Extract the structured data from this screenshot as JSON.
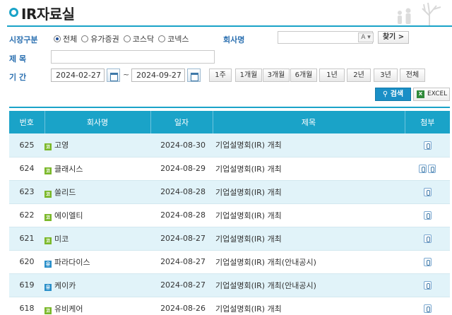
{
  "page": {
    "title": "IR자료실"
  },
  "filters": {
    "market_label": "시장구분",
    "market_options": [
      {
        "label": "전체",
        "checked": true
      },
      {
        "label": "유가증권",
        "checked": false
      },
      {
        "label": "코스닥",
        "checked": false
      },
      {
        "label": "코넥스",
        "checked": false
      }
    ],
    "company_label": "회사명",
    "company_value": "",
    "autocomplete_label": "A ▾",
    "find_label": "찾기 >",
    "subject_label": "제 목",
    "subject_value": "",
    "period_label": "기 간",
    "start_date": "2024-02-27",
    "date_separator": "~",
    "end_date": "2024-09-27",
    "period_buttons": [
      "1주",
      "1개월",
      "3개월",
      "6개월",
      "1년",
      "2년",
      "3년",
      "전체"
    ],
    "search_label": "검색",
    "excel_label": "EXCEL",
    "excel_icon_letter": "X"
  },
  "table": {
    "columns": [
      "번호",
      "회사명",
      "일자",
      "제목",
      "첨부"
    ],
    "rows": [
      {
        "no": "625",
        "market_badge": "코",
        "badge_color": "#7ab829",
        "company": "고영",
        "date": "2024-08-30",
        "title": "기업설명회(IR) 개최",
        "attachments": 1
      },
      {
        "no": "624",
        "market_badge": "코",
        "badge_color": "#7ab829",
        "company": "클래시스",
        "date": "2024-08-29",
        "title": "기업설명회(IR) 개최",
        "attachments": 2
      },
      {
        "no": "623",
        "market_badge": "코",
        "badge_color": "#7ab829",
        "company": "쏠리드",
        "date": "2024-08-28",
        "title": "기업설명회(IR) 개최",
        "attachments": 1
      },
      {
        "no": "622",
        "market_badge": "코",
        "badge_color": "#7ab829",
        "company": "에이엘티",
        "date": "2024-08-28",
        "title": "기업설명회(IR) 개최",
        "attachments": 1
      },
      {
        "no": "621",
        "market_badge": "코",
        "badge_color": "#7ab829",
        "company": "미코",
        "date": "2024-08-27",
        "title": "기업설명회(IR) 개최",
        "attachments": 1
      },
      {
        "no": "620",
        "market_badge": "유",
        "badge_color": "#2a8fc9",
        "company": "파라다이스",
        "date": "2024-08-27",
        "title": "기업설명회(IR) 개최(안내공시)",
        "attachments": 1
      },
      {
        "no": "619",
        "market_badge": "유",
        "badge_color": "#2a8fc9",
        "company": "케이카",
        "date": "2024-08-27",
        "title": "기업설명회(IR) 개최(안내공시)",
        "attachments": 1
      },
      {
        "no": "618",
        "market_badge": "코",
        "badge_color": "#7ab829",
        "company": "유비케어",
        "date": "2024-08-26",
        "title": "기업설명회(IR) 개최",
        "attachments": 1
      }
    ]
  },
  "colors": {
    "accent": "#1aa3c8",
    "label_blue": "#2a6fb0",
    "row_alt": "#e1f3f9",
    "search_button": "#1a8fc6",
    "excel_green": "#2f8a3a"
  }
}
